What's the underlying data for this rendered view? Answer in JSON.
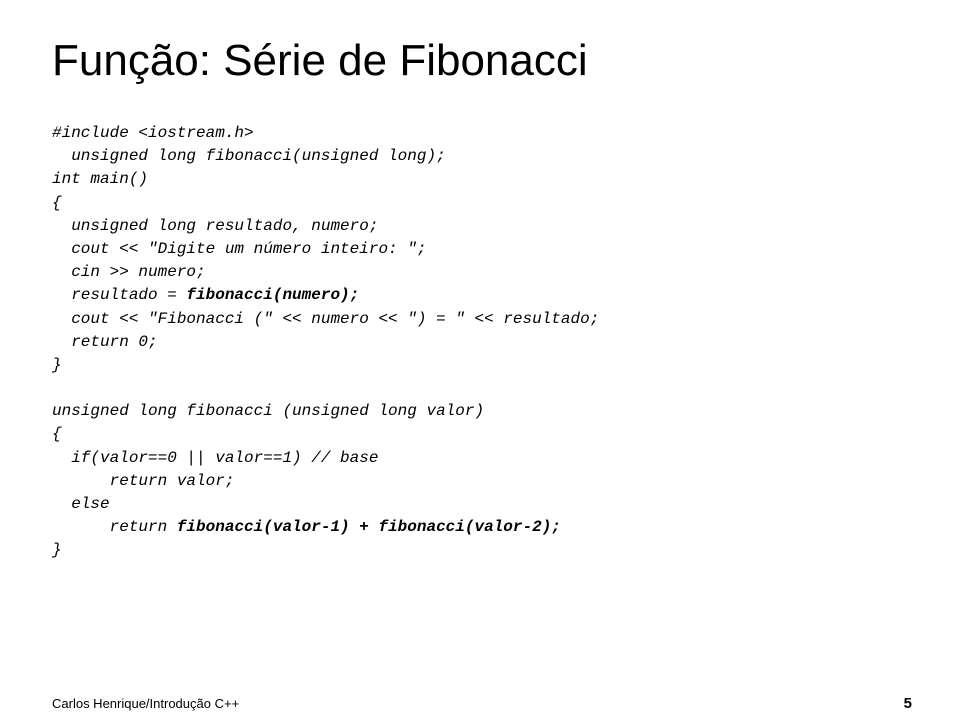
{
  "title": "Função: Série de Fibonacci",
  "code": {
    "include": "#include <iostream.h>",
    "prototype": "  unsigned long fibonacci(unsigned long);",
    "main_sig": "int main()",
    "brace_open": "{",
    "decl": "  unsigned long resultado, numero;",
    "prompt": "  cout << \"Digite um número inteiro: \";",
    "cin": "  cin >> numero;",
    "call_pre": "  resultado = ",
    "call_bold": "fibonacci(numero);",
    "cout_result": "  cout << \"Fibonacci (\" << numero << \") = \" << resultado;",
    "return0": "  return 0;",
    "brace_close": "}",
    "func_sig": "unsigned long fibonacci (unsigned long valor)",
    "func_open": "{",
    "ifline": "  if(valor==0 || valor==1) // base",
    "return_valor": "      return valor;",
    "else": "  else",
    "return_rec_pre": "      return ",
    "return_rec_bold": "fibonacci(valor-1) + fibonacci(valor-2);",
    "func_close": "}"
  },
  "footer": {
    "author": "Carlos Henrique/Introdução C++",
    "page": "5"
  }
}
